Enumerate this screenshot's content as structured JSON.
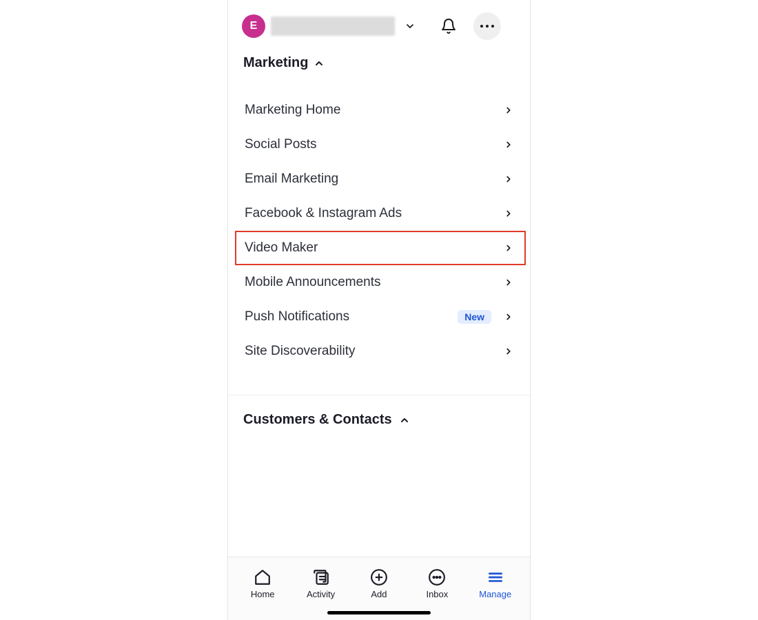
{
  "header": {
    "avatar_letter": "E"
  },
  "sections": {
    "marketing": {
      "title": "Marketing",
      "items": [
        {
          "label": "Marketing Home"
        },
        {
          "label": "Social Posts"
        },
        {
          "label": "Email Marketing"
        },
        {
          "label": "Facebook & Instagram Ads"
        },
        {
          "label": "Video Maker",
          "highlighted": true
        },
        {
          "label": "Mobile Announcements"
        },
        {
          "label": "Push Notifications",
          "badge": "New"
        },
        {
          "label": "Site Discoverability"
        }
      ]
    },
    "customers": {
      "title": "Customers & Contacts"
    }
  },
  "bottom_nav": {
    "home": "Home",
    "activity": "Activity",
    "add": "Add",
    "inbox": "Inbox",
    "manage": "Manage"
  }
}
